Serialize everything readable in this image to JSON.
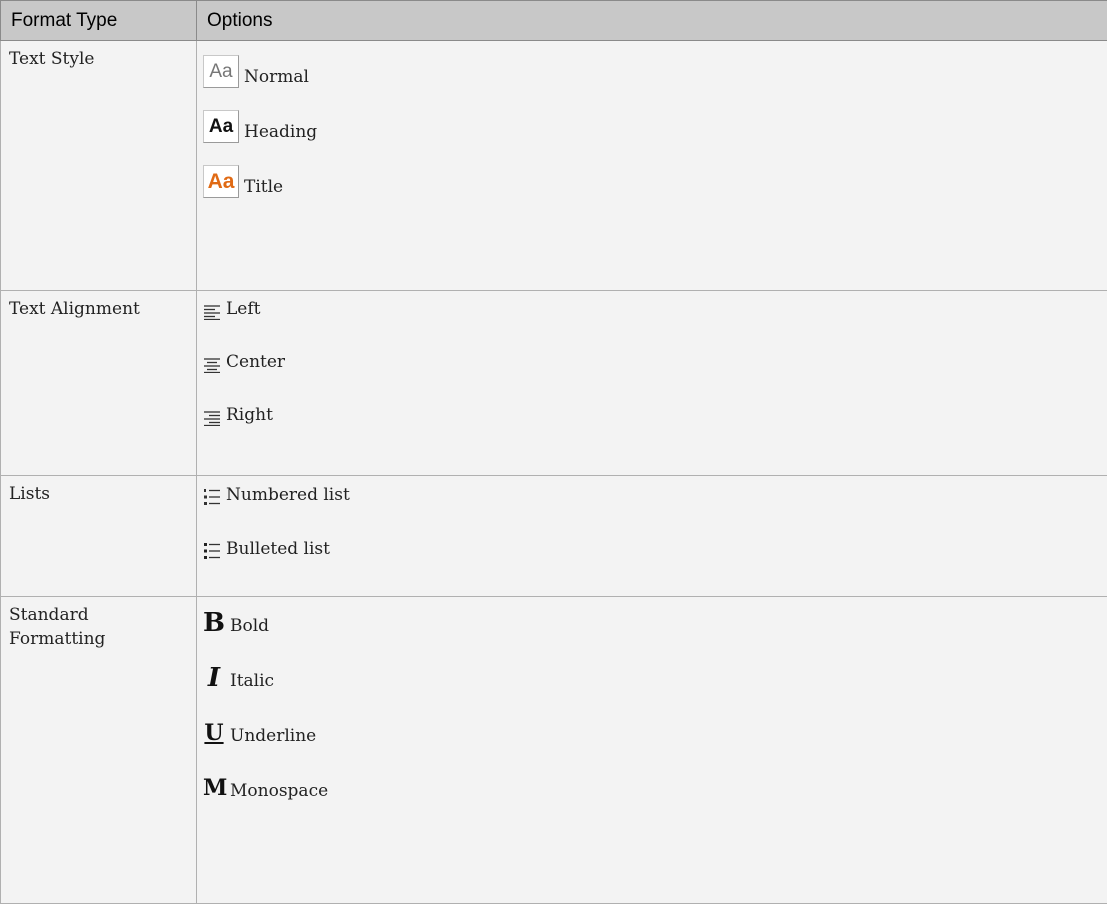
{
  "header": {
    "format_type": "Format Type",
    "options": "Options"
  },
  "rows": {
    "text_style": {
      "type": "Text Style",
      "swatch_text": "Aa",
      "options": [
        "Normal",
        "Heading",
        "Title"
      ],
      "title_color": "#e06a14"
    },
    "text_alignment": {
      "type": "Text Alignment",
      "options": [
        "Left",
        "Center",
        "Right"
      ]
    },
    "lists": {
      "type": "Lists",
      "options": [
        "Numbered list",
        "Bulleted list"
      ]
    },
    "standard_formatting": {
      "type": "Standard Formatting",
      "glyphs": [
        "B",
        "I",
        "U",
        "M"
      ],
      "options": [
        "Bold",
        "Italic",
        "Underline",
        "Monospace"
      ]
    }
  },
  "icons": {
    "normal": "text-style-normal-icon",
    "heading": "text-style-heading-icon",
    "title": "text-style-title-icon",
    "left": "align-left-icon",
    "center": "align-center-icon",
    "right": "align-right-icon",
    "numbered": "numbered-list-icon",
    "bulleted": "bulleted-list-icon",
    "bold": "bold-icon",
    "italic": "italic-icon",
    "underline": "underline-icon",
    "monospace": "monospace-icon"
  }
}
